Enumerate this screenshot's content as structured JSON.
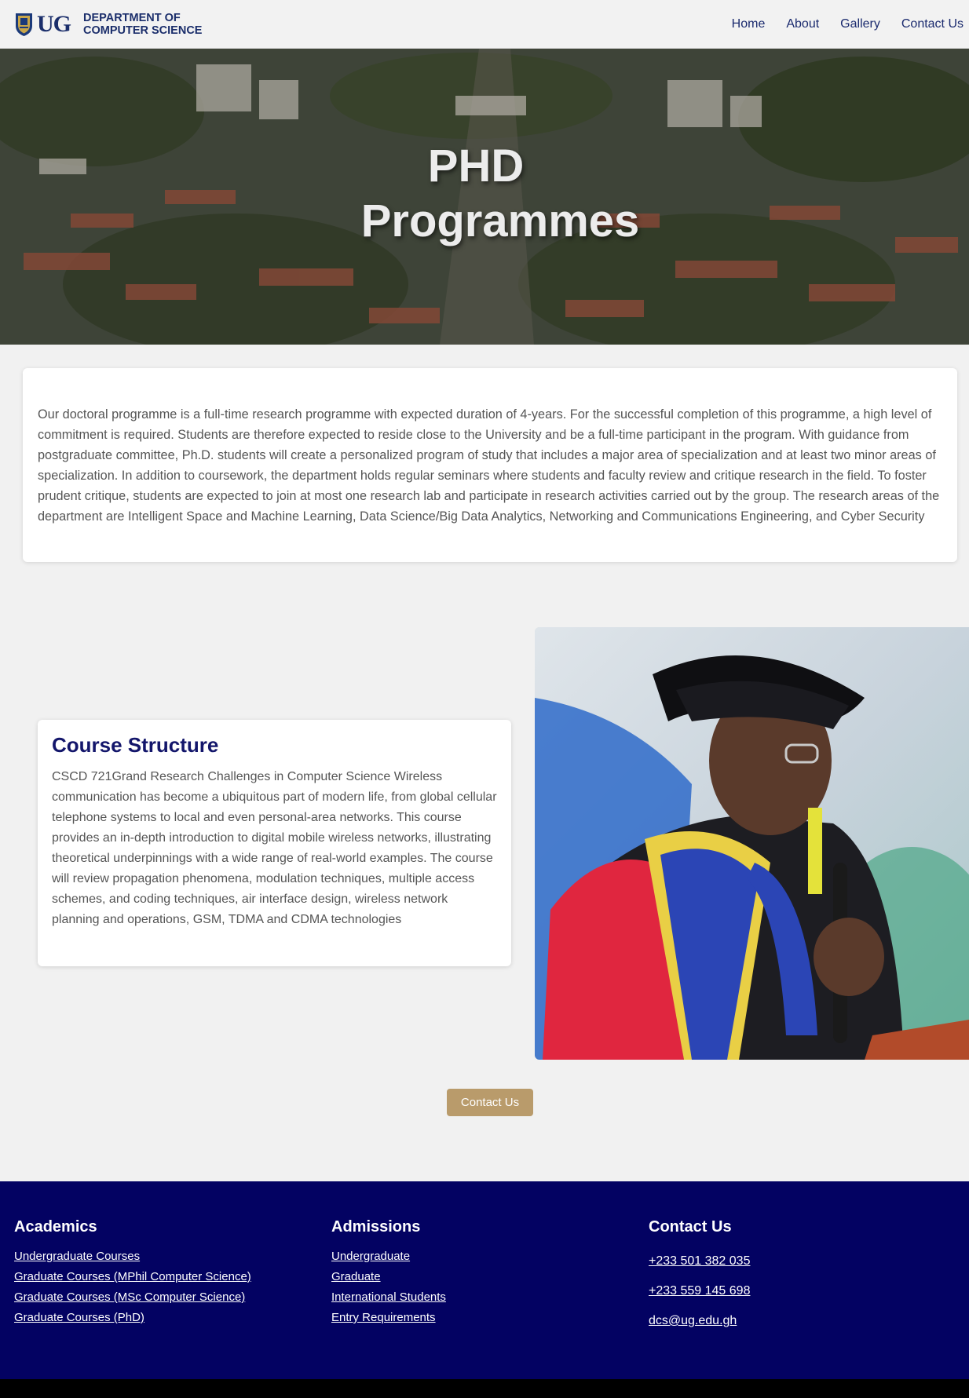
{
  "header": {
    "logo_text": "UG",
    "dept_line1": "DEPARTMENT OF",
    "dept_line2": "COMPUTER SCIENCE",
    "nav": [
      "Home",
      "About",
      "Gallery",
      "Contact Us"
    ]
  },
  "hero": {
    "title_line1": "PHD",
    "title_line2": "Programmes"
  },
  "intro": {
    "text": "Our doctoral programme is a full-time research programme with expected duration of 4-years. For the successful completion of this programme, a high level of commitment is required. Students are therefore expected to reside close to the University and be a full-time participant in the program. With guidance from postgraduate committee, Ph.D. students will create a personalized program of study that includes a major area of specialization and at least two minor areas of specialization. In addition to coursework, the department holds regular seminars where students and faculty review and critique research in the field. To foster prudent critique, students are expected to join at most one research lab and participate in research activities carried out by the group. The research areas of the department are Intelligent Space and Machine Learning, Data Science/Big Data Analytics, Networking and Communications Engineering, and Cyber Security"
  },
  "course": {
    "title": "Course Structure",
    "text": "CSCD 721Grand Research Challenges in Computer Science Wireless communication has become a ubiquitous part of modern life, from global cellular telephone systems to local and even personal-area networks. This course provides an in-depth introduction to digital mobile wireless networks, illustrating theoretical underpinnings with a wide range of real-world examples. The course will review propagation phenomena, modulation techniques, multiple access schemes, and coding techniques, air interface design, wireless network planning and operations, GSM, TDMA and CDMA technologies"
  },
  "cta": {
    "label": "Contact Us"
  },
  "footer": {
    "academics": {
      "title": "Academics",
      "items": [
        "Undergraduate Courses",
        "Graduate Courses (MPhil Computer Science)",
        "Graduate Courses (MSc Computer Science)",
        "Graduate Courses (PhD)"
      ]
    },
    "admissions": {
      "title": "Admissions",
      "items": [
        "Undergraduate",
        "Graduate",
        "International Students",
        "Entry Requirements"
      ]
    },
    "contact": {
      "title": "Contact Us",
      "items": [
        "+233 501 382 035",
        "+233 559 145 698",
        "dcs@ug.edu.gh"
      ]
    }
  },
  "colors": {
    "brand_navy": "#1b2e6b",
    "footer_bg": "#030262",
    "button_bg": "#b99b6b",
    "heading": "#13166b"
  }
}
